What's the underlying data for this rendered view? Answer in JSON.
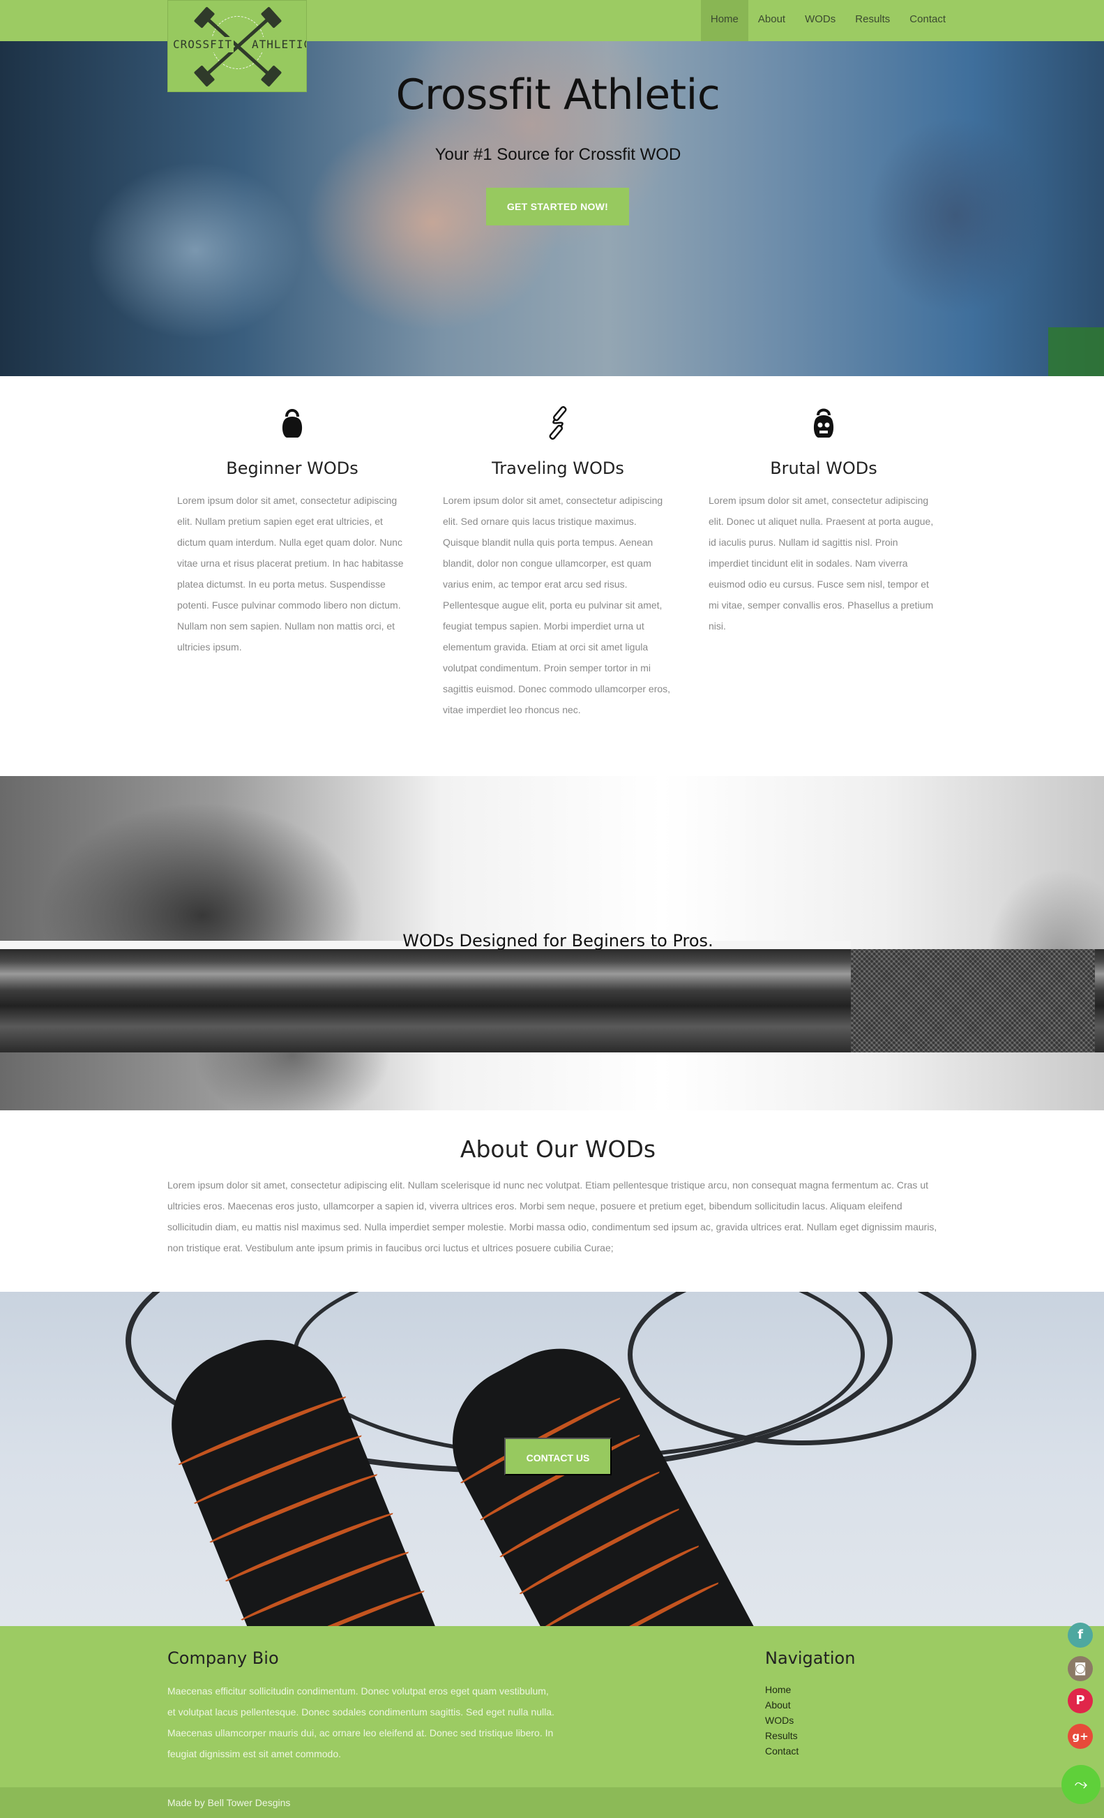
{
  "navbar": {
    "logo": {
      "left_word": "CROSSFIT",
      "right_word": "ATHLETIC"
    },
    "links": [
      "Home",
      "About",
      "WODs",
      "Results",
      "Contact"
    ],
    "active": "Home"
  },
  "hero": {
    "title": "Crossfit Athletic",
    "tagline": "Your #1 Source for Crossfit WOD",
    "cta": "GET STARTED NOW!"
  },
  "features": [
    {
      "icon": "kettlebell-icon",
      "title": "Beginner WODs",
      "text": "Lorem ipsum dolor sit amet, consectetur adipiscing elit. Nullam pretium sapien eget erat ultricies, et dictum quam interdum. Nulla eget quam dolor. Nunc vitae urna et risus placerat pretium. In hac habitasse platea dictumst. In eu porta metus. Suspendisse potenti. Fusce pulvinar commodo libero non dictum. Nullam non sem sapien. Nullam non mattis orci, et ultricies ipsum."
    },
    {
      "icon": "jump-rope-icon",
      "title": "Traveling WODs",
      "text": "Lorem ipsum dolor sit amet, consectetur adipiscing elit. Sed ornare quis lacus tristique maximus. Quisque blandit nulla quis porta tempus. Aenean blandit, dolor non congue ullamcorper, est quam varius enim, ac tempor erat arcu sed risus. Pellentesque augue elit, porta eu pulvinar sit amet, feugiat tempus sapien. Morbi imperdiet urna ut elementum gravida. Etiam at orci sit amet ligula volutpat condimentum. Proin semper tortor in mi sagittis euismod. Donec commodo ullamcorper eros, vitae imperdiet leo rhoncus nec."
    },
    {
      "icon": "skull-kettlebell-icon",
      "title": "Brutal WODs",
      "text": "Lorem ipsum dolor sit amet, consectetur adipiscing elit. Donec ut aliquet nulla. Praesent at porta augue, id iaculis purus. Nullam id sagittis nisl. Proin imperdiet tincidunt elit in sodales. Nam viverra euismod odio eu cursus. Fusce sem nisl, tempor et mi vitae, semper convallis eros. Phasellus a pretium nisi."
    }
  ],
  "banner": {
    "heading": "WODs Designed for Beginers to Pros."
  },
  "about": {
    "title": "About Our WODs",
    "text": "Lorem ipsum dolor sit amet, consectetur adipiscing elit. Nullam scelerisque id nunc nec volutpat. Etiam pellentesque tristique arcu, non consequat magna fermentum ac. Cras ut ultricies eros. Maecenas eros justo, ullamcorper a sapien id, viverra ultrices eros. Morbi sem neque, posuere et pretium eget, bibendum sollicitudin lacus. Aliquam eleifend sollicitudin diam, eu mattis nisl maximus sed. Nulla imperdiet semper molestie. Morbi massa odio, condimentum sed ipsum ac, gravida ultrices erat. Nullam eget dignissim mauris, non tristique erat. Vestibulum ante ipsum primis in faucibus orci luctus et ultrices posuere cubilia Curae;"
  },
  "contact": {
    "cta": "CONTACT US"
  },
  "footer": {
    "bio_title": "Company Bio",
    "bio_text": "Maecenas efficitur sollicitudin condimentum. Donec volutpat eros eget quam vestibulum, et volutpat lacus pellentesque. Donec sodales condimentum sagittis. Sed eget nulla nulla. Maecenas ullamcorper mauris dui, ac ornare leo eleifend at. Donec sed tristique libero. In feugiat dignissim est sit amet commodo.",
    "nav_title": "Navigation",
    "nav_links": [
      "Home",
      "About",
      "WODs",
      "Results",
      "Contact"
    ],
    "credit": "Made by Bell Tower Desgins"
  },
  "social": {
    "facebook": "f",
    "instagram": "◙",
    "pinterest": "P",
    "googleplus": "g+",
    "share": "⤳"
  },
  "colors": {
    "brand_green": "#9ccb63",
    "button_green": "#97c95f",
    "active_nav": "#89b654"
  }
}
